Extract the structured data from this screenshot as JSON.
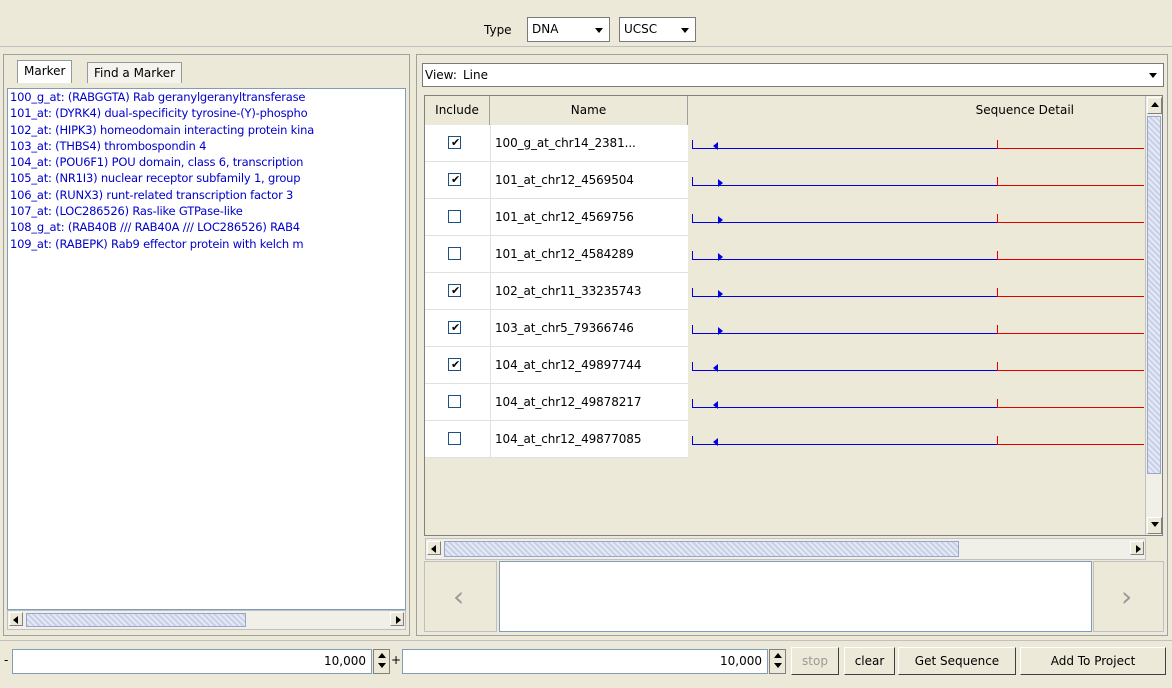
{
  "toolbar": {
    "type_label": "Type",
    "type_value": "DNA",
    "source_value": "UCSC"
  },
  "tabs": [
    {
      "label": "Marker"
    },
    {
      "label": "Find a Marker"
    }
  ],
  "markers": [
    "100_g_at: (RABGGTA) Rab geranylgeranyltransferase",
    "101_at: (DYRK4) dual-specificity tyrosine-(Y)-phospho",
    "102_at: (HIPK3) homeodomain interacting protein kina",
    "103_at: (THBS4) thrombospondin 4",
    "104_at: (POU6F1) POU domain, class 6, transcription",
    "105_at: (NR1I3) nuclear receptor subfamily 1, group",
    "106_at: (RUNX3) runt-related transcription factor 3",
    "107_at: (LOC286526) Ras-like GTPase-like",
    "108_g_at: (RAB40B /// RAB40A /// LOC286526) RAB4",
    "109_at: (RABEPK) Rab9 effector protein with kelch m"
  ],
  "view": {
    "label": "View:",
    "value": "Line"
  },
  "table": {
    "columns": {
      "include": "Include",
      "name": "Name",
      "detail": "Sequence Detail"
    },
    "rows": [
      {
        "include": true,
        "name": "100_g_at_chr14_2381...",
        "direction": "left"
      },
      {
        "include": true,
        "name": "101_at_chr12_4569504",
        "direction": "right"
      },
      {
        "include": false,
        "name": "101_at_chr12_4569756",
        "direction": "right"
      },
      {
        "include": false,
        "name": "101_at_chr12_4584289",
        "direction": "right"
      },
      {
        "include": true,
        "name": "102_at_chr11_33235743",
        "direction": "right"
      },
      {
        "include": true,
        "name": "103_at_chr5_79366746",
        "direction": "right"
      },
      {
        "include": true,
        "name": "104_at_chr12_49897744",
        "direction": "left"
      },
      {
        "include": false,
        "name": "104_at_chr12_49878217",
        "direction": "left"
      },
      {
        "include": false,
        "name": "104_at_chr12_49877085",
        "direction": "left"
      }
    ]
  },
  "nav": {
    "prev_glyph": "‹",
    "next_glyph": "›"
  },
  "bottom": {
    "minus_label": "-",
    "upstream_value": "10,000",
    "plus_label": "+",
    "downstream_value": "10,000",
    "stop_label": "stop",
    "clear_label": "clear",
    "get_sequence_label": "Get Sequence",
    "add_to_project_label": "Add To Project"
  },
  "colors": {
    "marker_text": "#0000cc",
    "upstream_line": "#0000e0",
    "downstream_line": "#e00000"
  }
}
